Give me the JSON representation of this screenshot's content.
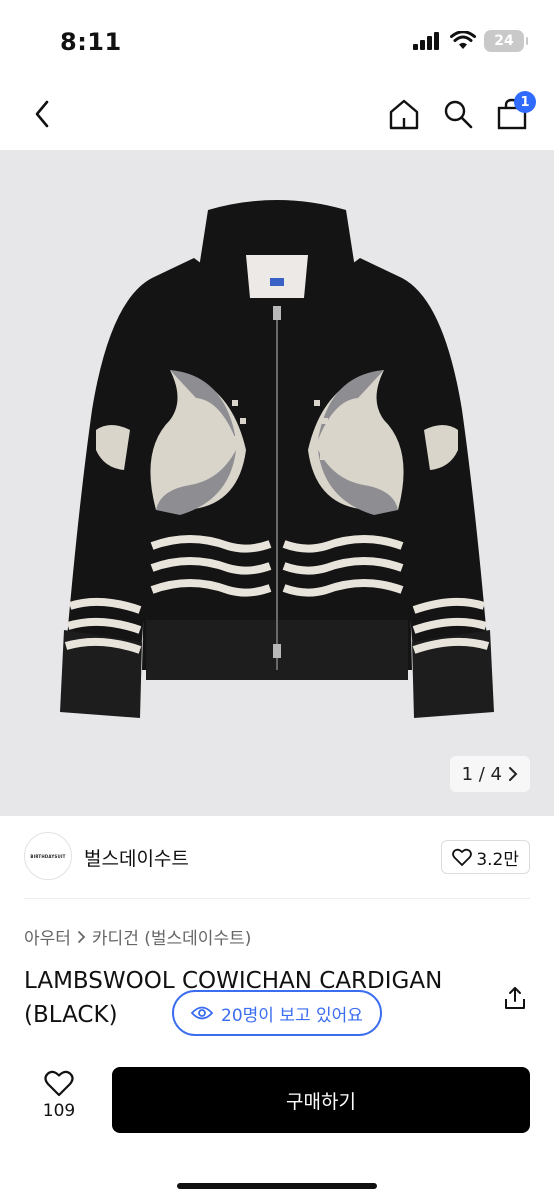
{
  "status_bar": {
    "time": "8:11",
    "battery": "24"
  },
  "nav": {
    "back_icon": "chevron-left-icon",
    "home_icon": "home-icon",
    "search_icon": "search-icon",
    "cart_icon": "shopping-bag-icon",
    "cart_badge": "1"
  },
  "image": {
    "counter": "1 / 4",
    "brand_label": "BIRTHDAYSUIT"
  },
  "shop": {
    "avatar_text": "BIRTHDAYSUIT",
    "name": "벌스데이수트",
    "likes": "3.2만"
  },
  "breadcrumb": {
    "level1": "아우터",
    "level2": "카디건 (벌스데이수트)"
  },
  "product": {
    "title": "LAMBSWOOL COWICHAN CARDIGAN (BLACK)"
  },
  "viewers": {
    "label": "20명이 보고 있어요"
  },
  "bottom": {
    "wish_count": "109",
    "buy_label": "구매하기"
  },
  "colors": {
    "accent": "#3b6df0",
    "badge": "#2f6bff",
    "buy_button": "#000000"
  }
}
